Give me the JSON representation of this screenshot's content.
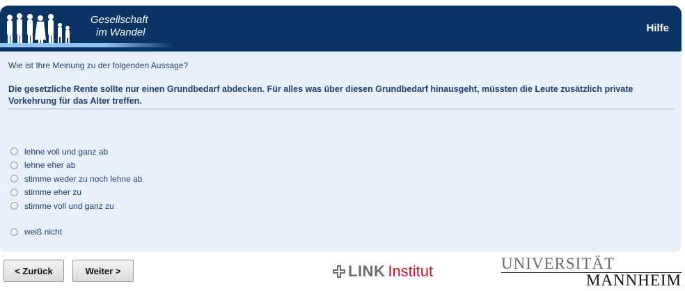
{
  "header": {
    "logo_line1": "Gesellschaft",
    "logo_line2": "im Wandel",
    "help_label": "Hilfe",
    "bg_color": "#0b3465"
  },
  "question": {
    "intro": "Wie ist Ihre Meinung zu der folgenden Aussage?",
    "statement": "Die gesetzliche Rente sollte nur einen Grundbedarf abdecken. Für alles was über diesen Grundbedarf hinausgeht, müssten die Leute zusätzlich private Vorkehrung für das Alter treffen."
  },
  "options": [
    {
      "label": "lehne voll und ganz ab",
      "selected": false
    },
    {
      "label": "lehne eher ab",
      "selected": false
    },
    {
      "label": "stimme weder zu noch lehne ab",
      "selected": false
    },
    {
      "label": "stimme eher zu",
      "selected": false
    },
    {
      "label": "stimme voll und ganz zu",
      "selected": false
    },
    {
      "label": "weiß nicht",
      "selected": false
    }
  ],
  "nav": {
    "back_label": "< Zurück",
    "next_label": "Weiter >"
  },
  "footer": {
    "link_logo_bold": "LINK",
    "link_logo_text": "Institut",
    "uni_line1": "UNIVERSITÄT",
    "uni_line2": "MANNHEIM"
  }
}
